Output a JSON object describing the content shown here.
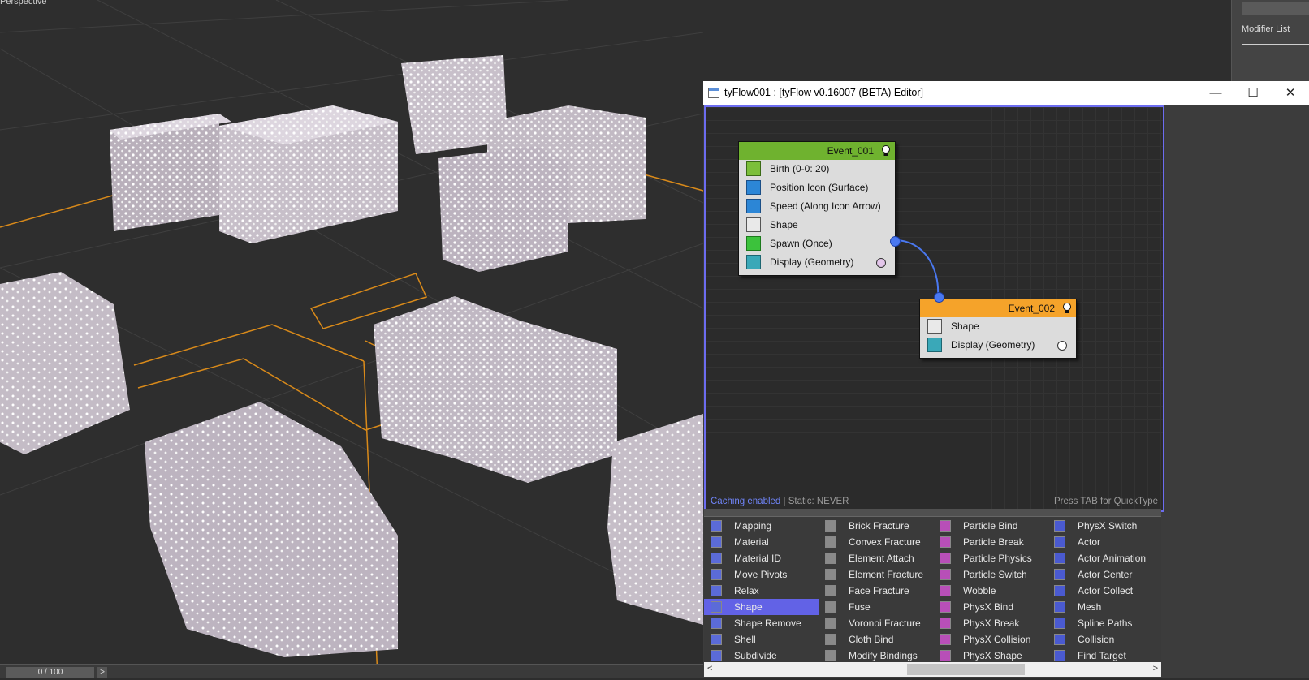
{
  "viewport": {
    "label": "Perspective"
  },
  "command_panel": {
    "modifier_list": "Modifier List"
  },
  "timeline": {
    "frame": "0 / 100",
    "next": ">"
  },
  "editor": {
    "title": "tyFlow001 : [tyFlow v0.16007 (BETA) Editor]",
    "controls": {
      "minimize": "—",
      "maximize": "☐",
      "close": "✕"
    },
    "status_caching": "Caching enabled",
    "status_static": " | Static: NEVER",
    "hint": "Press TAB for QuickType",
    "events": [
      {
        "name": "Event_001",
        "color": "#6fb22f",
        "operators": [
          {
            "label": "Birth (0-0: 20)",
            "icon": "birth-icon"
          },
          {
            "label": "Position Icon (Surface)",
            "icon": "position-icon"
          },
          {
            "label": "Speed (Along Icon Arrow)",
            "icon": "speed-icon"
          },
          {
            "label": "Shape",
            "icon": "shape-icon"
          },
          {
            "label": "Spawn (Once)",
            "icon": "spawn-icon"
          },
          {
            "label": "Display (Geometry)",
            "icon": "display-icon"
          }
        ]
      },
      {
        "name": "Event_002",
        "color": "#f5a32a",
        "operators": [
          {
            "label": "Shape",
            "icon": "shape-icon"
          },
          {
            "label": "Display (Geometry)",
            "icon": "display-icon"
          }
        ]
      }
    ],
    "palette": [
      [
        "Mapping",
        "Material",
        "Material ID",
        "Move Pivots",
        "Relax",
        "Shape",
        "Shape Remove",
        "Shell",
        "Subdivide"
      ],
      [
        "Brick Fracture",
        "Convex Fracture",
        "Element Attach",
        "Element Fracture",
        "Face Fracture",
        "Fuse",
        "Voronoi Fracture",
        "Cloth Bind",
        "Modify Bindings"
      ],
      [
        "Particle Bind",
        "Particle Break",
        "Particle Physics",
        "Particle Switch",
        "Wobble",
        "PhysX Bind",
        "PhysX Break",
        "PhysX Collision",
        "PhysX Shape"
      ],
      [
        "PhysX Switch",
        "Actor",
        "Actor Animation",
        "Actor Center",
        "Actor Collect",
        "Mesh",
        "Spline Paths",
        "Collision",
        "Find Target"
      ]
    ],
    "palette_selected": "Shape",
    "scroll_left": "<",
    "scroll_right": ">"
  }
}
